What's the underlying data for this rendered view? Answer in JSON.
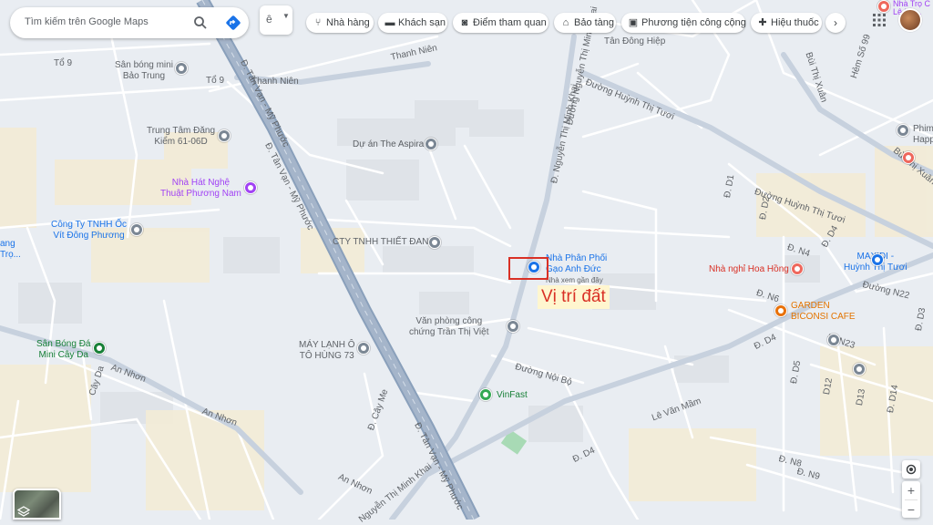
{
  "search": {
    "placeholder": "Tìm kiếm trên Google Maps"
  },
  "layer_button": {
    "label": "ê"
  },
  "chips": [
    {
      "label": "Nhà hàng",
      "icon": "fork-knife-icon"
    },
    {
      "label": "Khách sạn",
      "icon": "bed-icon"
    },
    {
      "label": "Điểm tham quan",
      "icon": "camera-icon"
    },
    {
      "label": "Bảo tàng",
      "icon": "museum-icon"
    },
    {
      "label": "Phương tiện công cộng",
      "icon": "bus-icon"
    },
    {
      "label": "Hiệu thuốc",
      "icon": "pharmacy-icon"
    }
  ],
  "annotation": {
    "label": "Vị trí đất",
    "color": "#d93025"
  },
  "streets": {
    "to9_a": "Tổ 9",
    "to9_b": "Tổ 9",
    "thanh_nien_1": "Thanh Niên",
    "thanh_nien_2": "Thanh Niên",
    "tan_van_1": "Đ. Tân Vạn - Mỹ Phước",
    "tan_van_2": "Đ. Tân Vạn - Mỹ Phước",
    "tan_van_3": "Đ. Tân Vạn - Mỹ Phước",
    "nguyen_tmk_1": "Đ. Nguyễn Thị Minh Khai",
    "nguyen_tmk_2": "Đường Nguyễn Thị Minh Khai",
    "nguyen_tmk_3": "Nguyễn Thị Minh Khai",
    "huynh_thi_tuoi_1": "Đường Huỳnh Thị Tươi",
    "huynh_thi_tuoi_2": "Đường Huỳnh Thị Tươi",
    "bui_thi_xuan_1": "Bùi Thị Xuân",
    "bui_thi_xuan_2": "Bùi Thị Xuân",
    "hem_so_99": "Hẻm Số 99",
    "an_nhon_1": "An Nhơn",
    "an_nhon_2": "An Nhơn",
    "an_nhon_3": "An Nhơn",
    "cay_da": "Cây Da",
    "cay_me": "Đ. Cây Me",
    "duong_noi_bo": "Đường Nội Bộ",
    "le_van_mam": "Lê Văn Mầm",
    "d4_1": "Đ. D4",
    "d4_2": "Đ. D4",
    "d4_3": "Đ. D4",
    "d1": "Đ. D1",
    "d2": "Đ. D2",
    "n4": "Đ. N4",
    "n6": "Đ. N6",
    "n8": "Đ. N8",
    "n9": "Đ. N9",
    "n23": "Đ. N23",
    "n22": "Đường N22",
    "d5": "Đ. D5",
    "d12": "D12",
    "d13": "D13",
    "d14": "Đ. D14",
    "d3": "Đ. D3"
  },
  "pois": {
    "san_bong_bao_trung": "Sân bóng mini\nBảo Trung",
    "trung_tam_dang_kiem": "Trung Tâm Đăng\nKiểm 61-06D",
    "du_an_aspira": "Dự án The Aspira",
    "nha_hat": "Nhà Hát Nghệ\nThuật Phương Nam",
    "cong_ty_oc_vit": "Công Ty TNHH Ốc\nVít Đông Phương",
    "cty_thiet_dan": "CTY TNHH THIẾT ĐAN",
    "nha_phan_phoi": "Nhà Phân Phối\nGạo Anh Đức",
    "nha_phan_phoi_sub": "Nhà xem gần đây",
    "van_phong_cong_chung": "Văn phòng công\nchứng Trần Thị Việt",
    "may_lanh": "MÁY LẠNH Ô\nTÔ HÙNG 73",
    "san_bong_cay_da": "Sân Bóng Đá\nMini Cây Da",
    "vinfast": "VinFast",
    "nha_nghi_hoa_hong": "Nhà nghỉ Hoa Hồng",
    "garden_biconsi": "GARDEN\nBICONSI CAFE",
    "maxidi": "MAXIDI -\nHuỳnh Thị Tươi",
    "tan_dong_hiep": "Tân Đông Hiệp",
    "phim_happ": "Phim\nHapp",
    "nha_tro": "Nhà Trọ C\nLê Hồ...",
    "left_edge": "ang\nTrọ..."
  },
  "controls": {
    "zoom_in": "+",
    "zoom_out": "−",
    "next_chip": "›"
  }
}
